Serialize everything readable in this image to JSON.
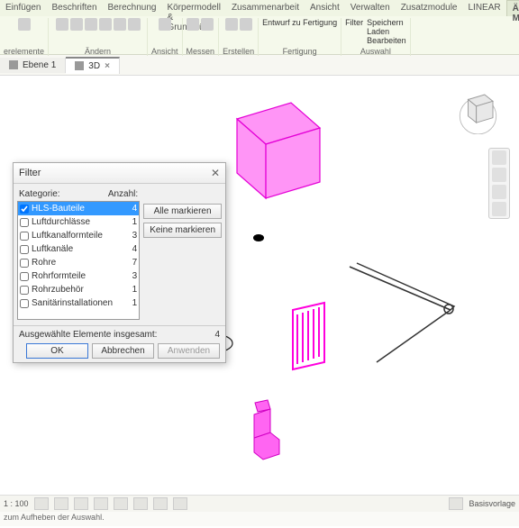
{
  "menubar": {
    "items": [
      "Einfügen",
      "Beschriften",
      "Berechnung",
      "Körpermodell & Grundstück",
      "Zusammenarbeit",
      "Ansicht",
      "Verwalten",
      "Zusatzmodule",
      "LINEAR",
      "Ändern | Mehrfachauswahl"
    ],
    "active_index": 9
  },
  "ribbon": {
    "groups": [
      {
        "label": "erelemente"
      },
      {
        "label": "Ändern"
      },
      {
        "label": "Ansicht"
      },
      {
        "label": "Messen"
      },
      {
        "label": "Erstellen"
      }
    ],
    "right_items": [
      "Speichern",
      "Laden",
      "Bearbeiten"
    ],
    "right_group1": "Fertigung",
    "right_group2": "Auswahl",
    "btn_entwurf": "Entwurf zu\nFertigung",
    "btn_filter": "Filter"
  },
  "tabbar": {
    "tabs": [
      {
        "label": "Ebene 1",
        "active": false
      },
      {
        "label": "3D",
        "active": true
      }
    ]
  },
  "dialog": {
    "title": "Filter",
    "col1": "Kategorie:",
    "col2": "Anzahl:",
    "rows": [
      {
        "label": "HLS-Bauteile",
        "count": 4,
        "checked": true,
        "selected": true
      },
      {
        "label": "Luftdurchlässe",
        "count": 1,
        "checked": false
      },
      {
        "label": "Luftkanalformteile",
        "count": 3,
        "checked": false
      },
      {
        "label": "Luftkanäle",
        "count": 4,
        "checked": false
      },
      {
        "label": "Rohre",
        "count": 7,
        "checked": false
      },
      {
        "label": "Rohrformteile",
        "count": 3,
        "checked": false
      },
      {
        "label": "Rohrzubehör",
        "count": 1,
        "checked": false
      },
      {
        "label": "Sanitärinstallationen",
        "count": 1,
        "checked": false
      }
    ],
    "btn_all": "Alle markieren",
    "btn_none": "Keine markieren",
    "sum_label": "Ausgewählte Elemente insgesamt:",
    "sum_value": "4",
    "btn_ok": "OK",
    "btn_cancel": "Abbrechen",
    "btn_apply": "Anwenden"
  },
  "statusbar": {
    "scale": "1 : 100",
    "template": "Basisvorlage"
  },
  "hint": "zum Aufheben der Auswahl."
}
